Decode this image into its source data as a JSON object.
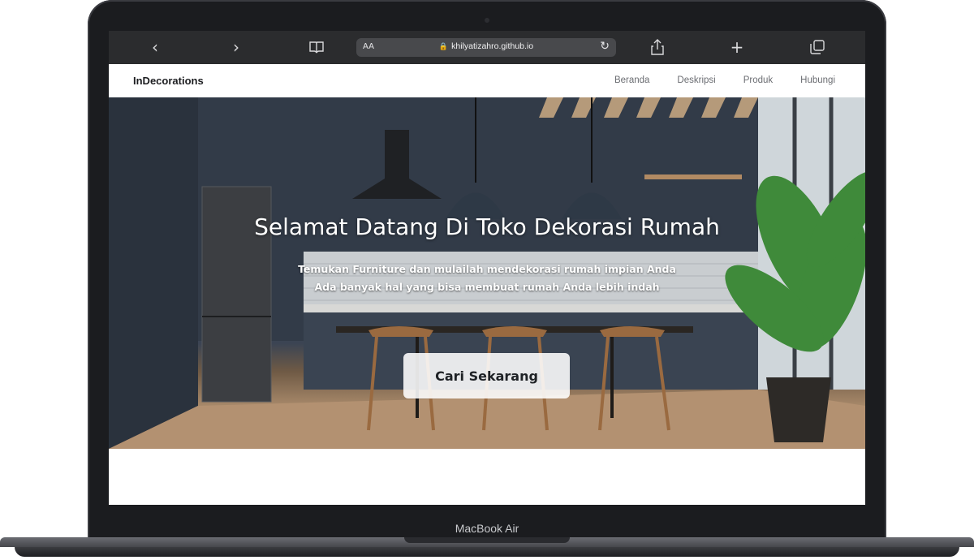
{
  "device": {
    "brand_label": "MacBook Air"
  },
  "browser": {
    "text_size_label": "AA",
    "url": "khilyatizahro.github.io",
    "icons": [
      "back-icon",
      "forward-icon",
      "book-icon",
      "lock-icon",
      "reload-icon",
      "share-icon",
      "plus-icon",
      "tabs-icon"
    ]
  },
  "site": {
    "logo": "InDecorations",
    "nav": [
      "Beranda",
      "Deskripsi",
      "Produk",
      "Hubungi"
    ]
  },
  "hero": {
    "title": "Selamat Datang Di Toko Dekorasi Rumah",
    "subtitle_line1": "Temukan Furniture dan mulailah mendekorasi rumah impian Anda",
    "subtitle_line2": "Ada banyak hal yang bisa membuat rumah Anda lebih indah",
    "cta_label": "Cari Sekarang"
  },
  "colors": {
    "toolbar": "#2b2c2e",
    "hero_wall": "#303947",
    "floor": "#b49372",
    "plant": "#3f8a3a"
  }
}
